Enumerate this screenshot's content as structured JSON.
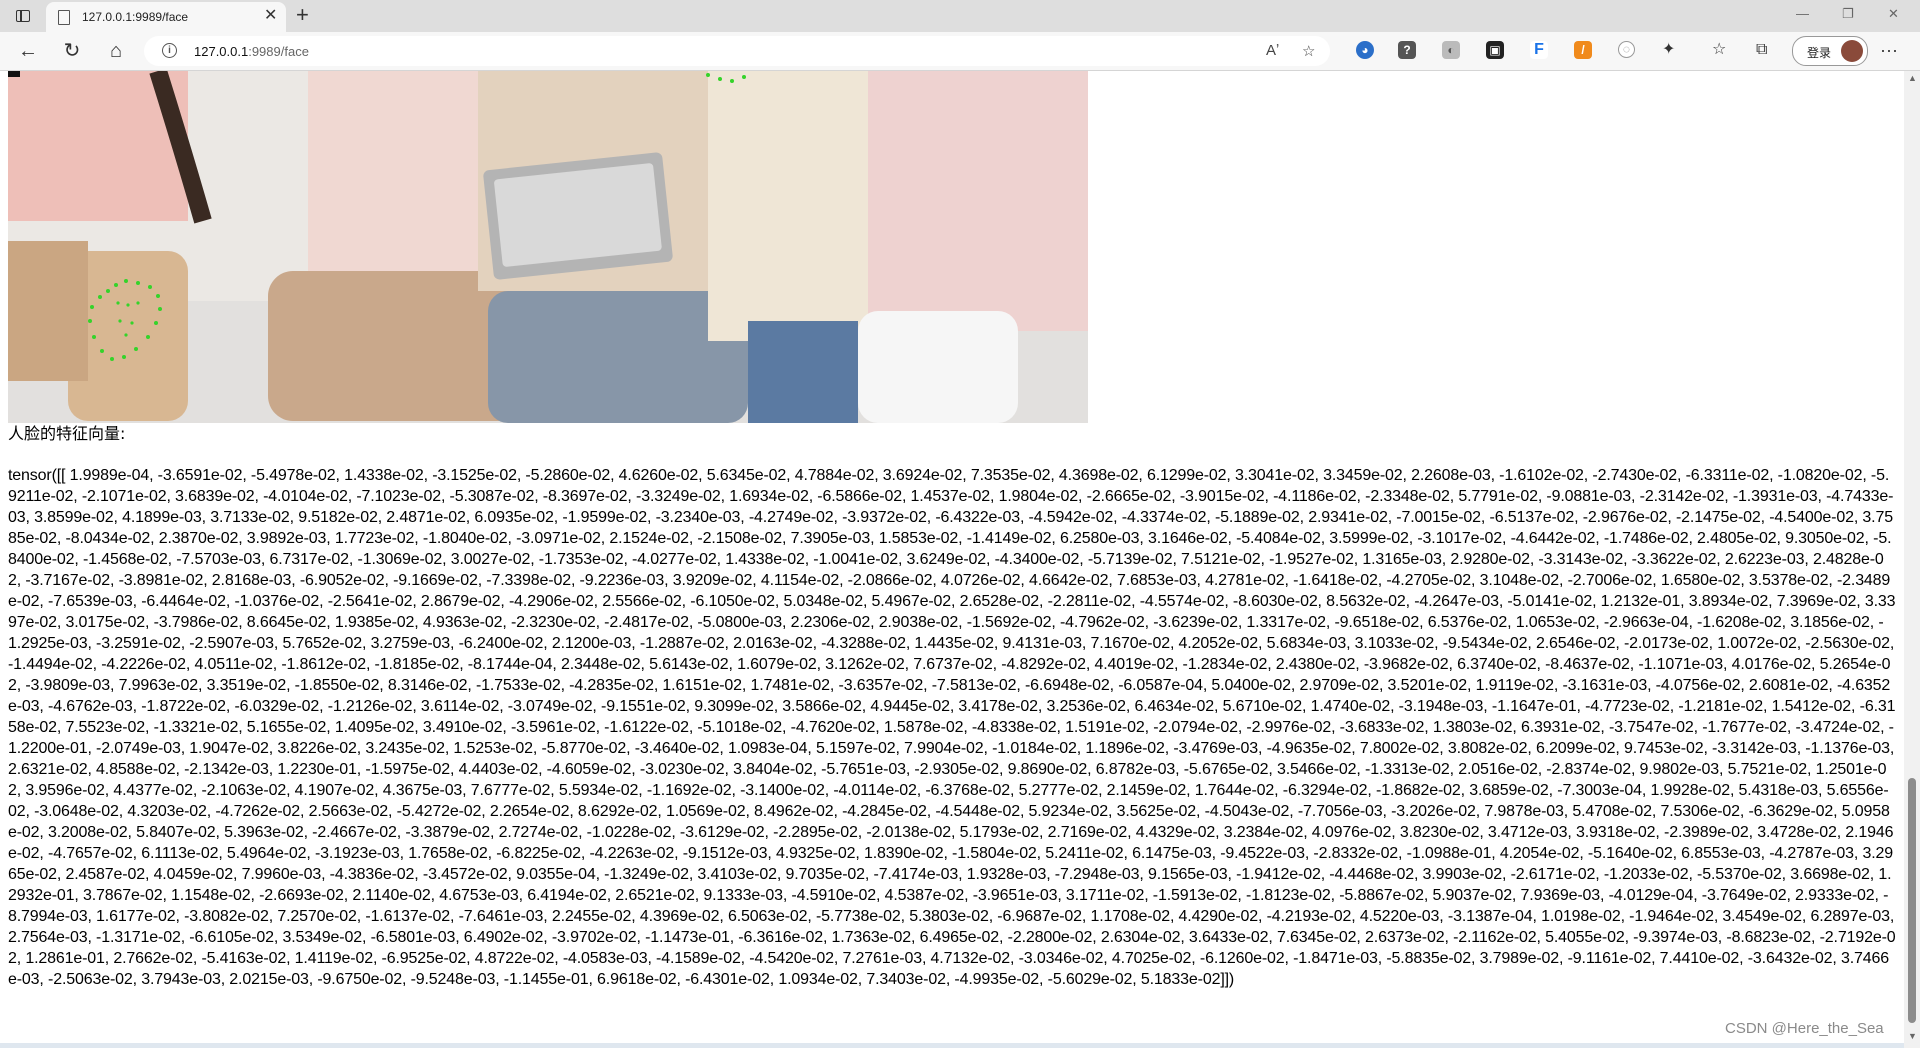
{
  "browser": {
    "tab_title": "127.0.0.1:9989/face",
    "url_host": "127.0.0.1",
    "url_rest": ":9989/face",
    "login_label": "登录",
    "icons": [
      "tab-actions-icon",
      "page-icon",
      "close-icon",
      "new-tab-icon",
      "minimize-icon",
      "restore-icon",
      "close-window-icon",
      "back-icon",
      "refresh-icon",
      "home-icon",
      "site-info-icon",
      "read-aloud-icon",
      "favorite-add-icon",
      "extensions-icon",
      "favorites-icon",
      "collections-icon",
      "more-icon"
    ]
  },
  "page": {
    "caption": "人脸的特征向量:",
    "tensor_text": "tensor([[ 1.9989e-04, -3.6591e-02, -5.4978e-02, 1.4338e-02, -3.1525e-02, -5.2860e-02, 4.6260e-02, 5.6345e-02, 4.7884e-02, 3.6924e-02, 7.3535e-02, 4.3698e-02, 6.1299e-02, 3.3041e-02, 3.3459e-02, 2.2608e-03, -1.6102e-02, -2.7430e-02, -6.3311e-02, -1.0820e-02, -5.9211e-02, -2.1071e-02, 3.6839e-02, -4.0104e-02, -7.1023e-02, -5.3087e-02, -8.3697e-02, -3.3249e-02, 1.6934e-02, -6.5866e-02, 1.4537e-02, 1.9804e-02, -2.6665e-02, -3.9015e-02, -4.1186e-02, -2.3348e-02, 5.7791e-02, -9.0881e-03, -2.3142e-02, -1.3931e-03, -4.7433e-03, 3.8599e-02, 4.1899e-03, 3.7133e-02, 9.5182e-02, 2.4871e-02, 6.0935e-02, -1.9599e-02, -3.2340e-03, -4.2749e-02, -3.9372e-02, -6.4322e-03, -4.5942e-02, -4.3374e-02, -5.1889e-02, 2.9341e-02, -7.0015e-02, -6.5137e-02, -2.9676e-02, -2.1475e-02, -4.5400e-02, 3.7585e-02, -8.0434e-02, 2.3870e-02, 3.9892e-03, 1.7723e-02, -1.8040e-02, -3.0971e-02, 2.1524e-02, -2.1508e-02, 7.3905e-03, 1.5853e-02, -1.4149e-02, 6.2580e-03, 3.1646e-02, -5.4084e-02, 3.5999e-02, -3.1017e-02, -4.6442e-02, -1.7486e-02, 2.4805e-02, 9.3050e-02, -5.8400e-02, -1.4568e-02, -7.5703e-03, 6.7317e-02, -1.3069e-02, 3.0027e-02, -1.7353e-02, -4.0277e-02, 1.4338e-02, -1.0041e-02, 3.6249e-02, -4.3400e-02, -5.7139e-02, 7.5121e-02, -1.9527e-02, 1.3165e-03, 2.9280e-02, -3.3143e-02, -3.3622e-02, 2.6223e-03, 2.4828e-02, -3.7167e-02, -3.8981e-02, 2.8168e-03, -6.9052e-02, -9.1669e-02, -7.3398e-02, -9.2236e-03, 3.9209e-02, 4.1154e-02, -2.0866e-02, 4.0726e-02, 4.6642e-02, 7.6853e-03, 4.2781e-02, -1.6418e-02, -4.2705e-02, 3.1048e-02, -2.7006e-02, 1.6580e-02, 3.5378e-02, -2.3489e-02, -7.6539e-03, -6.4464e-02, -1.0376e-02, -2.5641e-02, 2.8679e-02, -4.2906e-02, 2.5566e-02, -6.1050e-02, 5.0348e-02, 5.4967e-02, 2.6528e-02, -2.2811e-02, -4.5574e-02, -8.6030e-02, 8.5632e-02, -4.2647e-03, -5.0141e-02, 1.2132e-01, 3.8934e-02, 7.3969e-02, 3.3397e-02, 3.0175e-02, -3.7986e-02, 8.6645e-02, 1.9385e-02, 4.9363e-02, -2.3230e-02, -2.4817e-02, -5.0800e-03, 2.2306e-02, 2.9038e-02, -1.5692e-02, -4.7962e-02, -3.6239e-02, 1.3317e-02, -9.6518e-02, 6.5376e-02, 1.0653e-02, -2.9663e-04, -1.6208e-02, 3.1856e-02, -1.2925e-03, -3.2591e-02, -2.5907e-03, 5.7652e-02, 3.2759e-03, -6.2400e-02, 2.1200e-03, -1.2887e-02, 2.0163e-02, -4.3288e-02, 1.4435e-02, 9.4131e-03, 7.1670e-02, 4.2052e-02, 5.6834e-03, 3.1033e-02, -9.5434e-02, 2.6546e-02, -2.0173e-02, 1.0072e-02, -2.5630e-02, -1.4494e-02, -4.2226e-02, 4.0511e-02, -1.8612e-02, -1.8185e-02, -8.1744e-04, 2.3448e-02, 5.6143e-02, 1.6079e-02, 3.1262e-02, 7.6737e-02, -4.8292e-02, 4.4019e-02, -1.2834e-02, 2.4380e-02, -3.9682e-02, 6.3740e-02, -8.4637e-02, -1.1071e-03, 4.0176e-02, 5.2654e-02, -3.9809e-03, 7.9963e-02, 3.3519e-02, -1.8550e-02, 8.3146e-02, -1.7533e-02, -4.2835e-02, 1.6151e-02, 1.7481e-02, -3.6357e-02, -7.5813e-02, -6.6948e-02, -6.0587e-04, 5.0400e-02, 2.9709e-02, 3.5201e-02, 1.9119e-02, -3.1631e-03, -4.0756e-02, 2.6081e-02, -4.6352e-03, -4.6762e-03, -1.8722e-02, -6.0329e-02, -1.2126e-02, 3.6114e-02, -3.0749e-02, -9.1551e-02, 9.3099e-02, 3.5866e-02, 4.9445e-02, 3.4178e-02, 3.2536e-02, 6.4634e-02, 5.6710e-02, 1.4740e-02, -3.1948e-03, -1.1647e-01, -4.7723e-02, -1.2181e-02, 1.5412e-02, -6.3158e-02, 7.5523e-02, -1.3321e-02, 5.1655e-02, 1.4095e-02, 3.4910e-02, -3.5961e-02, -1.6122e-02, -5.1018e-02, -4.7620e-02, 1.5878e-02, -4.8338e-02, 1.5191e-02, -2.0794e-02, -2.9976e-02, -3.6833e-02, 1.3803e-02, 6.3931e-02, -3.7547e-02, -1.7677e-02, -3.4724e-02, -1.2200e-01, -2.0749e-03, 1.9047e-02, 3.8226e-02, 3.2435e-02, 1.5253e-02, -5.8770e-02, -3.4640e-02, 1.0983e-04, 5.1597e-02, 7.9904e-02, -1.0184e-02, 1.1896e-02, -3.4769e-03, -4.9635e-02, 7.8002e-02, 3.8082e-02, 6.2099e-02, 9.7453e-02, -3.3142e-03, -1.1376e-03, 2.6321e-02, 4.8588e-02, -2.1342e-03, 1.2230e-01, -1.5975e-02, 4.4403e-02, -4.6059e-02, -3.0230e-02, 3.8404e-02, -5.7651e-03, -2.9305e-02, 9.8690e-02, 6.8782e-03, -5.6765e-02, 3.5466e-02, -1.3313e-02, 2.0516e-02, -2.8374e-02, 9.9802e-03, 5.7521e-02, 1.2501e-02, 3.9596e-02, 4.4377e-02, -2.1063e-02, 4.1907e-02, 4.3675e-03, 7.6777e-02, 5.5934e-02, -1.1692e-02, -3.1400e-02, -4.0114e-02, -6.3768e-02, 5.2777e-02, 2.1459e-02, 1.7644e-02, -6.3294e-02, -1.8682e-02, 3.6859e-02, -7.3003e-04, 1.9928e-02, 5.4318e-03, 5.6556e-02, -3.0648e-02, 4.3203e-02, -4.7262e-02, 2.5663e-02, -5.4272e-02, 2.2654e-02, 8.6292e-02, 1.0569e-02, 8.4962e-02, -4.2845e-02, -4.5448e-02, 5.9234e-02, 3.5625e-02, -4.5043e-02, -7.7056e-03, -3.2026e-02, 7.9878e-03, 5.4708e-02, 7.5306e-02, -6.3629e-02, 5.0958e-02, 3.2008e-02, 5.8407e-02, 5.3963e-02, -2.4667e-02, -3.3879e-02, 2.7274e-02, -1.0228e-02, -3.6129e-02, -2.2895e-02, -2.0138e-02, 5.1793e-02, 2.7169e-02, 4.4329e-02, 3.2384e-02, 4.0976e-02, 3.8230e-02, 3.4712e-03, 3.9318e-02, -2.3989e-02, 3.4728e-02, 2.1946e-02, -4.7657e-02, 6.1113e-02, 5.4964e-02, -3.1923e-03, 1.7658e-02, -6.8225e-02, -4.2263e-02, -9.1512e-03, 4.9325e-02, 1.8390e-02, -1.5804e-02, 5.2411e-02, 6.1475e-03, -9.4522e-03, -2.8332e-02, -1.0988e-01, 4.2054e-02, -5.1640e-02, 6.8553e-03, -4.2787e-03, 3.2965e-02, 2.4587e-02, 4.0459e-02, 7.9960e-03, -4.3836e-02, -3.4572e-02, 9.0355e-04, -1.3249e-02, 3.4103e-02, 9.7035e-02, -7.4174e-03, 1.9328e-03, -7.2948e-03, 9.1565e-03, -1.9412e-02, -4.4468e-02, 3.9903e-02, -2.6171e-02, -1.2033e-02, -5.5370e-02, 3.6698e-02, 1.2932e-01, 3.7867e-02, 1.1548e-02, -2.6693e-02, 2.1140e-02, 4.6753e-03, 6.4194e-02, 2.6521e-02, 9.1333e-03, -4.5910e-02, 4.5387e-02, -3.9651e-03, 3.1711e-02, -1.5913e-02, -1.8123e-02, -5.8867e-02, 5.9037e-02, 7.9369e-03, -4.0129e-04, -3.7649e-02, 2.9333e-02, -8.7994e-03, 1.6177e-02, -3.8082e-02, 7.2570e-02, -1.6137e-02, -7.6461e-03, 2.2455e-02, 4.3969e-02, 6.5063e-02, -5.7738e-02, 5.3803e-02, -6.9687e-02, 1.1708e-02, 4.4290e-02, -4.2193e-02, 4.5220e-03, -3.1387e-04, 1.0198e-02, -1.9464e-02, 3.4549e-02, 6.2897e-03, 2.7564e-03, -1.3171e-02, -6.6105e-02, 3.5349e-02, -6.5801e-03, 6.4902e-02, -3.9702e-02, -1.1473e-01, -6.3616e-02, 1.7363e-02, 6.4965e-02, -2.2800e-02, 2.6304e-02, 3.6433e-02, 7.6345e-02, 2.6373e-02, -2.1162e-02, 5.4055e-02, -9.3974e-03, -8.6823e-02, -2.7192e-02, 1.2861e-01, 2.7662e-02, -5.4163e-02, 1.4119e-02, -6.9525e-02, 4.8722e-02, -4.0583e-03, -4.1589e-02, -4.5420e-02, 7.2761e-03, 4.7132e-02, -3.0346e-02, 4.7025e-02, -6.1260e-02, -1.8471e-03, -5.8835e-02, 3.7989e-02, -9.1161e-02, 7.4410e-02, -3.6432e-02, 3.7466e-03, -2.5063e-02, 3.7943e-03, 2.0215e-03, -9.6750e-02, -9.5248e-03, -1.1455e-01, 6.9618e-02, -6.4301e-02, 1.0934e-02, 7.3403e-02, -4.9935e-02, -5.6029e-02, 5.1833e-02]])"
  },
  "watermark": "CSDN @Here_the_Sea"
}
